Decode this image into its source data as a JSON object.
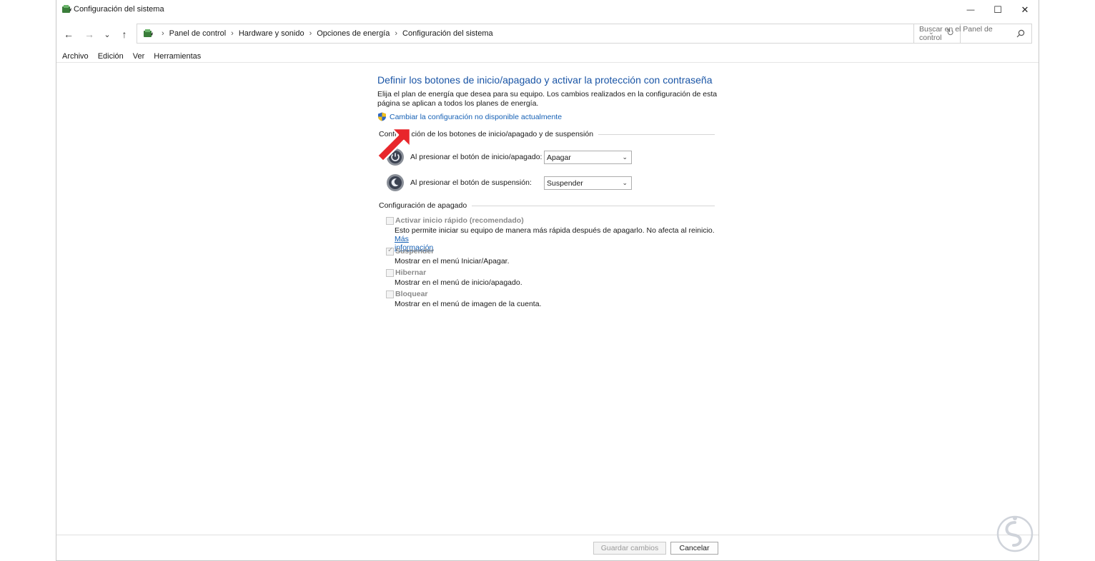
{
  "window": {
    "title": "Configuración del sistema",
    "min_glyph": "—",
    "max_glyph": "☐",
    "close_glyph": "✕"
  },
  "nav": {
    "back_glyph": "←",
    "forward_glyph": "→",
    "recent_glyph": "⌄",
    "up_glyph": "↑",
    "breadcrumbs": [
      "Panel de control",
      "Hardware y sonido",
      "Opciones de energía",
      "Configuración del sistema"
    ],
    "separator": "›",
    "dropdown_glyph": "⌄",
    "refresh_glyph": "↻",
    "search_placeholder": "Buscar en el Panel de control"
  },
  "menu": [
    "Archivo",
    "Edición",
    "Ver",
    "Herramientas"
  ],
  "content": {
    "title": "Definir los botones de inicio/apagado y activar la protección con contraseña",
    "description": "Elija el plan de energía que desea para su equipo. Los cambios realizados en la configuración de esta página se aplican a todos los planes de energía.",
    "change_settings_link": "Cambiar la configuración no disponible actualmente",
    "power_section_title": "Configuración de los botones de inicio/apagado y de suspensión",
    "power_rows": [
      {
        "label": "Al presionar el botón de inicio/apagado:",
        "value": "Apagar"
      },
      {
        "label": "Al presionar el botón de suspensión:",
        "value": "Suspender"
      }
    ],
    "shutdown_section_title": "Configuración de apagado",
    "options": [
      {
        "label": "Activar inicio rápido (recomendado)",
        "checked": false,
        "desc": "Esto permite iniciar su equipo de manera más rápida después de apagarlo. No afecta al reinicio.",
        "more_link": "Más",
        "more_link_2": "información"
      },
      {
        "label": "Suspender",
        "checked": true,
        "desc": "Mostrar en el menú Iniciar/Apagar."
      },
      {
        "label": "Hibernar",
        "checked": false,
        "desc": "Mostrar en el menú de inicio/apagado."
      },
      {
        "label": "Bloquear",
        "checked": false,
        "desc": "Mostrar en el menú de imagen de la cuenta."
      }
    ]
  },
  "footer": {
    "save_label": "Guardar cambios",
    "cancel_label": "Cancelar"
  },
  "colors": {
    "title_blue": "#1a55a6",
    "link_blue": "#1560b5",
    "arrow_red": "#e8262b"
  },
  "icons": {
    "app": "power-options-icon",
    "shield": "uac-shield-icon",
    "power_button": "power-button-icon",
    "sleep_button": "sleep-button-icon",
    "search": "search-icon",
    "watermark": "watermark-logo-icon"
  }
}
